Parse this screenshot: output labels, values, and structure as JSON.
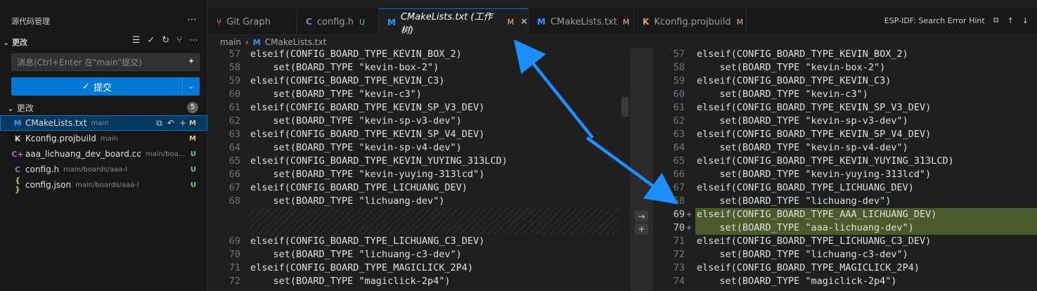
{
  "sidebar": {
    "title": "源代码管理",
    "section_title": "更改",
    "commit_input_placeholder": "消息(Ctrl+Enter 在\"main\"提交)",
    "commit_label": "提交",
    "group_title": "更改",
    "group_count": "5",
    "files": [
      {
        "name": "CMakeLists.txt",
        "path": "main",
        "status": "M",
        "icon": "M",
        "icon_color": "#3794ff",
        "status_color": "#e2c08d"
      },
      {
        "name": "Kconfig.projbuild",
        "path": "main",
        "status": "M",
        "icon": "K",
        "icon_color": "#cccccc",
        "status_color": "#e2c08d"
      },
      {
        "name": "aaa_lichuang_dev_board.cc",
        "path": "main/boa...",
        "status": "U",
        "icon": "C+",
        "icon_color": "#a074c4",
        "status_color": "#73c991"
      },
      {
        "name": "config.h",
        "path": "main/boards/aaa-lichuang-dev",
        "status": "U",
        "icon": "C",
        "icon_color": "#a074c4",
        "status_color": "#73c991"
      },
      {
        "name": "config.json",
        "path": "main/boards/aaa-lichuang-dev",
        "status": "U",
        "icon": "{ }",
        "icon_color": "#cbcb41",
        "status_color": "#73c991"
      }
    ]
  },
  "tabs": [
    {
      "label": "Git Graph",
      "icon": "⑂",
      "icon_color": "#e06c75",
      "mark": "",
      "mark_color": ""
    },
    {
      "label": "config.h",
      "icon": "C",
      "icon_color": "#a074c4",
      "mark": "U",
      "mark_color": "#73c991"
    },
    {
      "label": "CMakeLists.txt (工作树)",
      "icon": "M",
      "icon_color": "#3794ff",
      "mark": "M",
      "mark_color": "#e2c08d"
    },
    {
      "label": "CMakeLists.txt",
      "icon": "M",
      "icon_color": "#3794ff",
      "mark": "M",
      "mark_color": "#e2c08d"
    },
    {
      "label": "Kconfig.projbuild",
      "icon": "K",
      "icon_color": "#e8a33d",
      "mark": "M",
      "mark_color": "#e2c08d"
    }
  ],
  "tab_right_label": "ESP-IDF: Search Error Hint",
  "breadcrumb": {
    "folder": "main",
    "file": "CMakeLists.txt"
  },
  "left_lines": [
    {
      "n": "57",
      "t": "elseif(CONFIG_BOARD_TYPE_KEVIN_BOX_2)"
    },
    {
      "n": "58",
      "t": "    set(BOARD_TYPE \"kevin-box-2\")"
    },
    {
      "n": "59",
      "t": "elseif(CONFIG_BOARD_TYPE_KEVIN_C3)"
    },
    {
      "n": "60",
      "t": "    set(BOARD_TYPE \"kevin-c3\")"
    },
    {
      "n": "61",
      "t": "elseif(CONFIG_BOARD_TYPE_KEVIN_SP_V3_DEV)"
    },
    {
      "n": "62",
      "t": "    set(BOARD_TYPE \"kevin-sp-v3-dev\")"
    },
    {
      "n": "63",
      "t": "elseif(CONFIG_BOARD_TYPE_KEVIN_SP_V4_DEV)"
    },
    {
      "n": "64",
      "t": "    set(BOARD_TYPE \"kevin-sp-v4-dev\")"
    },
    {
      "n": "65",
      "t": "elseif(CONFIG_BOARD_TYPE_KEVIN_YUYING_313LCD)"
    },
    {
      "n": "66",
      "t": "    set(BOARD_TYPE \"kevin-yuying-313lcd\")"
    },
    {
      "n": "67",
      "t": "elseif(CONFIG_BOARD_TYPE_LICHUANG_DEV)"
    },
    {
      "n": "68",
      "t": "    set(BOARD_TYPE \"lichuang-dev\")"
    },
    {
      "n": "",
      "t": "",
      "hatch": true
    },
    {
      "n": "",
      "t": "",
      "hatch": true
    },
    {
      "n": "69",
      "t": "elseif(CONFIG_BOARD_TYPE_LICHUANG_C3_DEV)"
    },
    {
      "n": "70",
      "t": "    set(BOARD_TYPE \"lichuang-c3-dev\")"
    },
    {
      "n": "71",
      "t": "elseif(CONFIG_BOARD_TYPE_MAGICLICK_2P4)"
    },
    {
      "n": "72",
      "t": "    set(BOARD_TYPE \"magiclick-2p4\")"
    }
  ],
  "right_lines": [
    {
      "n": "57",
      "t": "elseif(CONFIG_BOARD_TYPE_KEVIN_BOX_2)"
    },
    {
      "n": "58",
      "t": "    set(BOARD_TYPE \"kevin-box-2\")"
    },
    {
      "n": "59",
      "t": "elseif(CONFIG_BOARD_TYPE_KEVIN_C3)"
    },
    {
      "n": "60",
      "t": "    set(BOARD_TYPE \"kevin-c3\")"
    },
    {
      "n": "61",
      "t": "elseif(CONFIG_BOARD_TYPE_KEVIN_SP_V3_DEV)"
    },
    {
      "n": "62",
      "t": "    set(BOARD_TYPE \"kevin-sp-v3-dev\")"
    },
    {
      "n": "63",
      "t": "elseif(CONFIG_BOARD_TYPE_KEVIN_SP_V4_DEV)"
    },
    {
      "n": "64",
      "t": "    set(BOARD_TYPE \"kevin-sp-v4-dev\")"
    },
    {
      "n": "65",
      "t": "elseif(CONFIG_BOARD_TYPE_KEVIN_YUYING_313LCD)"
    },
    {
      "n": "66",
      "t": "    set(BOARD_TYPE \"kevin-yuying-313lcd\")"
    },
    {
      "n": "67",
      "t": "elseif(CONFIG_BOARD_TYPE_LICHUANG_DEV)"
    },
    {
      "n": "68",
      "t": "    set(BOARD_TYPE \"lichuang-dev\")"
    },
    {
      "n": "69",
      "t": "elseif(CONFIG_BOARD_TYPE_AAA_LICHUANG_DEV)",
      "added": true
    },
    {
      "n": "70",
      "t": "    set(BOARD_TYPE \"aaa-lichuang-dev\")",
      "added": true
    },
    {
      "n": "71",
      "t": "elseif(CONFIG_BOARD_TYPE_LICHUANG_C3_DEV)"
    },
    {
      "n": "72",
      "t": "    set(BOARD_TYPE \"lichuang-c3-dev\")"
    },
    {
      "n": "73",
      "t": "elseif(CONFIG_BOARD_TYPE_MAGICLICK_2P4)"
    },
    {
      "n": "74",
      "t": "    set(BOARD_TYPE \"magiclick-2p4\")"
    }
  ]
}
